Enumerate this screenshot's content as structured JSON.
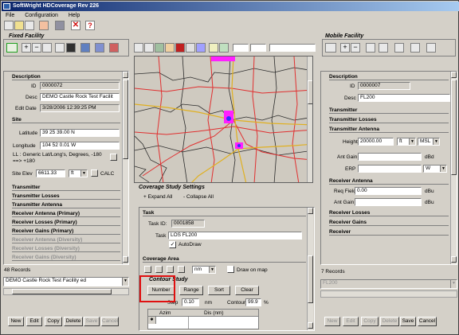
{
  "app": {
    "title": "SoftWright HDCoverage Rev 226"
  },
  "menu": {
    "file": "File",
    "configuration": "Configuration",
    "help": "Help"
  },
  "fixed": {
    "group_title": "Fixed Facility",
    "description_header": "Description",
    "id_label": "ID",
    "id_value": "0000072",
    "desc_label": "Desc",
    "desc_value": "DEMO Castle Rock Test Facilit",
    "edit_label": "Edit Date",
    "edit_value": "3/28/2006 12:39:25 PM",
    "site_header": "Site",
    "lat_label": "Latitude",
    "lat_value": "39 25 39.00 N",
    "lon_label": "Longitude",
    "lon_value": "104 52 0.01 W",
    "ll_note": "LL : Generic Lat/Long's, Degrees, -180 ==> +180",
    "elev_label": "Site Elev",
    "elev_value": "6611.33",
    "elev_unit": "ft",
    "calc": "CALC",
    "sections": [
      "Transmitter",
      "Transmitter Losses",
      "Transmitter Antenna",
      "Receiver Antenna (Primary)",
      "Receiver Losses (Primary)",
      "Receiver Gains (Primary)"
    ],
    "div_sections": [
      "Receiver Antenna (Diversity)",
      "Receiver Losses (Diversity)",
      "Receiver Gains (Diversity)"
    ],
    "records": "48 Records",
    "selector": "DEMO Castle Rock Test Facility ed",
    "buttons": [
      "New",
      "Edit",
      "Copy",
      "Delete",
      "Save",
      "Cancel"
    ]
  },
  "mobile": {
    "group_title": "Mobile Facility",
    "description_header": "Description",
    "id_label": "ID",
    "id_value": "0000007",
    "desc_label": "Desc",
    "desc_value": "FL200",
    "sections1": [
      "Transmitter",
      "Transmitter Losses"
    ],
    "ant_header": "Transmitter Antenna",
    "height_label": "Height",
    "height_value": "20000.00",
    "height_unit": "ft",
    "height_ref": "MSL",
    "antgain_label": "Ant Gain",
    "antgain_unit": "dBd",
    "erp_label": "ERP",
    "erp_unit": "W",
    "rx_header": "Receiver Antenna",
    "reqfield_label": "Req Field",
    "reqfield_value": "0.00",
    "reqfield_unit": "dBu",
    "rxgain_label": "Ant Gain",
    "rxgain_unit": "dBu",
    "sections2": [
      "Receiver Losses",
      "Receiver Gains",
      "Receiver"
    ],
    "records": "7 Records",
    "selector": "FL200",
    "buttons": [
      "New",
      "Edit",
      "Copy",
      "Delete",
      "Save",
      "Cancel"
    ]
  },
  "coverage": {
    "title": "Coverage Study Settings",
    "expand": "+ Expand All",
    "collapse": "- Collapse All",
    "task_header": "Task",
    "taskid_label": "Task ID:",
    "taskid_value": "0001858",
    "task_label": "Task",
    "task_value": "LOS  FL200",
    "autodraw": "AutoDraw",
    "area_header": "Coverage Area",
    "unit": "nm",
    "draw_on_map": "Draw on map",
    "contour_title": "Contour Study",
    "number": "Number",
    "range": "Range",
    "sort": "Sort",
    "clear": "Clear",
    "step_label": "Step",
    "step_value": "0.10",
    "step_unit": "nm",
    "contour_label": "Contour",
    "contour_value": "99.9",
    "contour_unit": "%",
    "col_azim": "Azim",
    "col_dis": "Dis (nm)"
  }
}
